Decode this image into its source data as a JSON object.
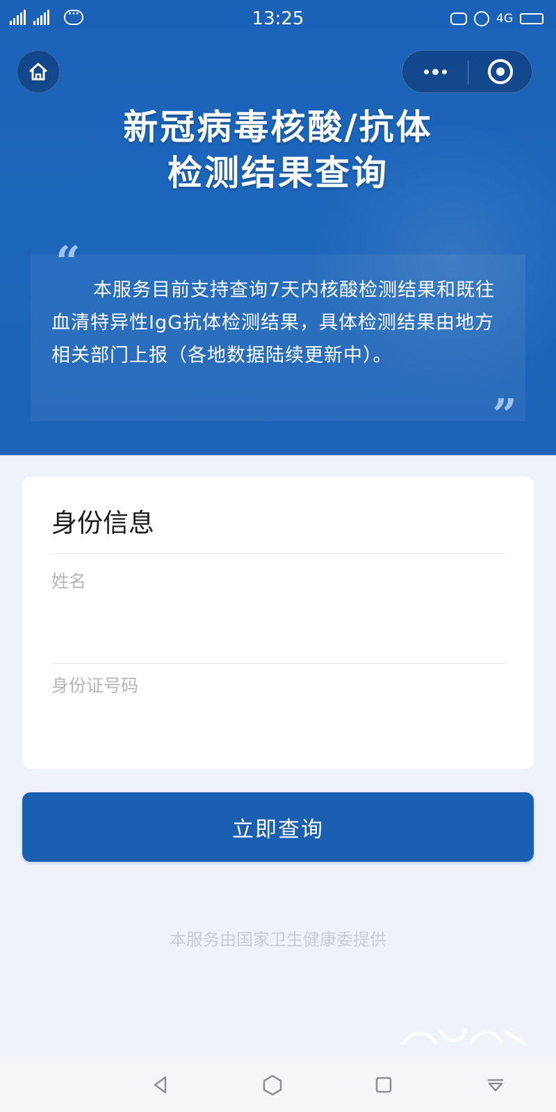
{
  "status_bar": {
    "signal_1_label": "",
    "signal_2_label": "",
    "time": "13:25",
    "network": "4G"
  },
  "nav": {
    "home_icon": "home-icon",
    "more_icon": "more-dots-icon",
    "close_icon": "target-close-icon"
  },
  "header": {
    "title_line1": "新冠病毒核酸/抗体",
    "title_line2": "检测结果查询"
  },
  "notice": {
    "text": "本服务目前支持查询7天内核酸检测结果和既往血清特异性IgG抗体检测结果，具体检测结果由地方相关部门上报（各地数据陆续更新中）。"
  },
  "identity_card": {
    "title": "身份信息",
    "name_placeholder": "姓名",
    "name_value": "",
    "id_placeholder": "身份证号码",
    "id_value": ""
  },
  "query_button": {
    "label": "立即查询"
  },
  "footer": {
    "provider_note": "本服务由国家卫生健康委提供"
  },
  "colors": {
    "hero_blue": "#1c66bb",
    "button_blue": "#1b5fb1",
    "page_bg": "#eef3fa"
  }
}
